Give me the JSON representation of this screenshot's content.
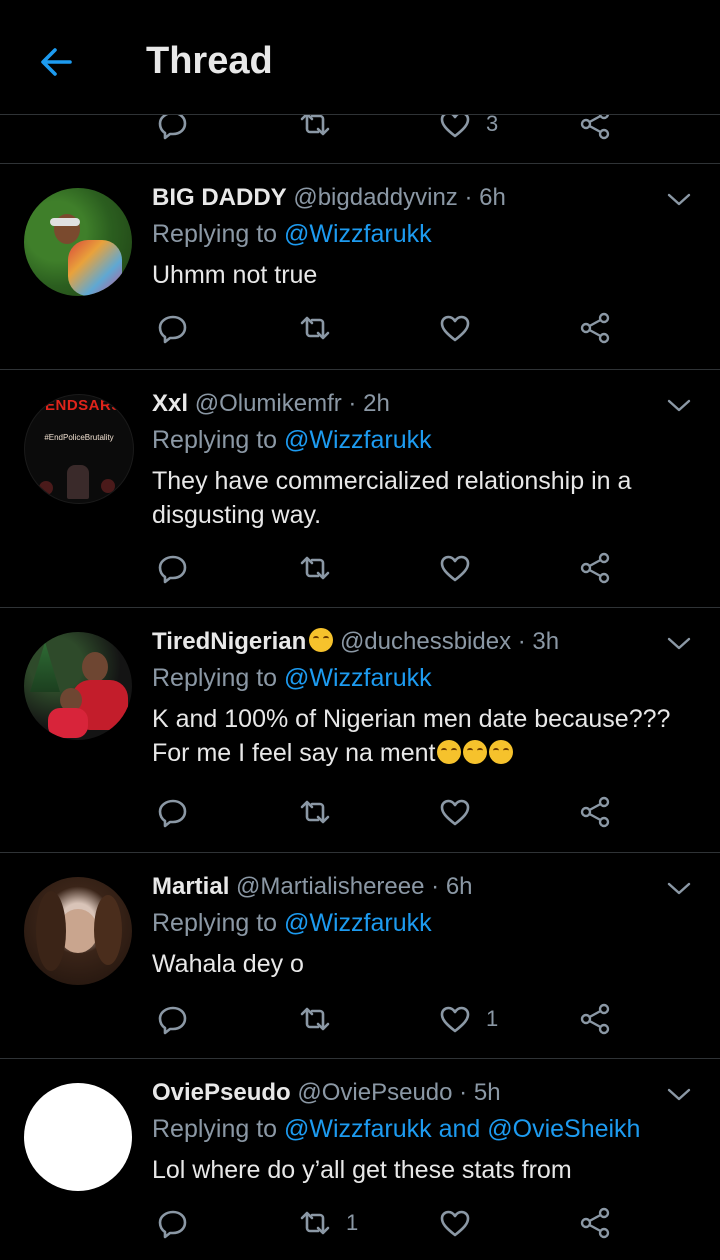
{
  "header": {
    "title": "Thread"
  },
  "top_actions": {
    "like_count": "3"
  },
  "tweets": [
    {
      "name": "BIG DADDY",
      "handle": "@bigdaddyvinz",
      "sep": "·",
      "time": "6h",
      "replying_prefix": "Replying to",
      "replying_to": "@Wizzfarukk",
      "text": "Uhmm not true",
      "reply_count": "",
      "retweet_count": "",
      "like_count": ""
    },
    {
      "name": "Xxl",
      "handle": "@Olumikemfr",
      "sep": "·",
      "time": "2h",
      "replying_prefix": "Replying to",
      "replying_to": "@Wizzfarukk",
      "text": "They have commercialized relationship in a disgusting way.",
      "avatar_text": "#ENDSARS",
      "avatar_subtext": "#EndPoliceBrutality",
      "reply_count": "",
      "retweet_count": "",
      "like_count": ""
    },
    {
      "name": "TiredNigerian",
      "handle": "@duchessbidex",
      "sep": "·",
      "time": "3h",
      "replying_prefix": "Replying to",
      "replying_to": "@Wizzfarukk",
      "text_line1": "K and 100% of Nigerian men date because???",
      "text_line2": "For me I feel say na ment",
      "reply_count": "",
      "retweet_count": "",
      "like_count": ""
    },
    {
      "name": "Martial",
      "handle": "@Martialishereee",
      "sep": "·",
      "time": "6h",
      "replying_prefix": "Replying to",
      "replying_to": "@Wizzfarukk",
      "text": "Wahala dey o",
      "reply_count": "",
      "retweet_count": "",
      "like_count": "1"
    },
    {
      "name": "OviePseudo",
      "handle": "@OviePseudo",
      "sep": "·",
      "time": "5h",
      "replying_prefix": "Replying to",
      "replying_to": "@Wizzfarukk and @OvieSheikh",
      "text": "Lol where do y’all get these stats from",
      "reply_count": "",
      "retweet_count": "1",
      "like_count": ""
    }
  ],
  "icons": {
    "reply": "reply-icon",
    "retweet": "retweet-icon",
    "like": "heart-icon",
    "share": "share-icon",
    "back": "back-arrow-icon",
    "more": "chevron-down-icon"
  },
  "colors": {
    "background": "#000000",
    "link": "#1d9bf0",
    "muted": "#8b98a5",
    "divider": "#2f3336"
  }
}
